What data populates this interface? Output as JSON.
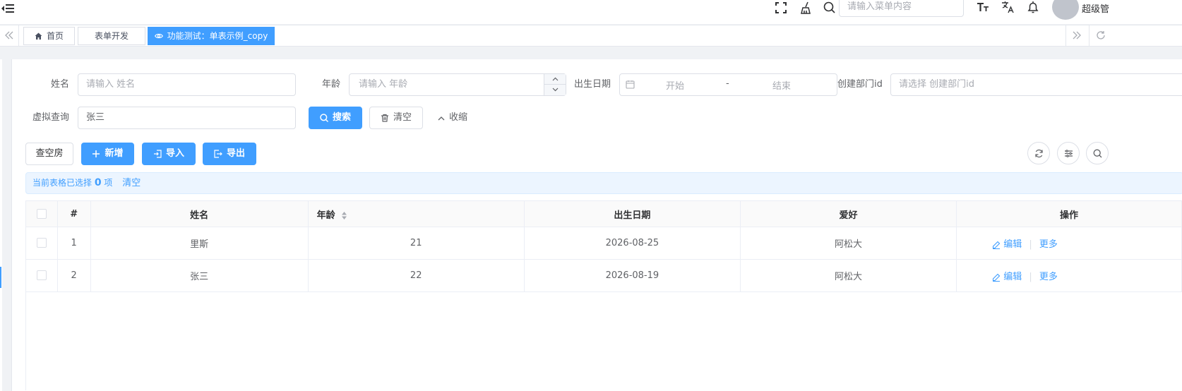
{
  "header": {
    "menu_search_placeholder": "请输入菜单内容",
    "user_name": "超级管"
  },
  "tags": [
    {
      "label": "首页"
    },
    {
      "label": "表单开发"
    },
    {
      "label": "功能测试：单表示例_copy"
    }
  ],
  "search_form": {
    "name_label": "姓名",
    "name_placeholder": "请输入 姓名",
    "age_label": "年龄",
    "age_placeholder": "请输入 年龄",
    "birth_label": "出生日期",
    "birth_start": "开始",
    "birth_sep": "-",
    "birth_end": "结束",
    "dept_label": "创建部门id",
    "dept_placeholder": "请选择 创建部门id",
    "virtual_label": "虚拟查询",
    "virtual_value": "张三",
    "search_label": "搜索",
    "reset_label": "清空",
    "collapse_label": "收缩"
  },
  "toolbar": {
    "room_label": "查空房",
    "add_label": "新增",
    "import_label": "导入",
    "export_label": "导出"
  },
  "selection": {
    "prefix": "当前表格已选择",
    "count": "0",
    "suffix": "项",
    "clear": "清空"
  },
  "table": {
    "columns": {
      "index": "#",
      "name": "姓名",
      "age": "年龄",
      "birth": "出生日期",
      "hobby": "爱好",
      "actions": "操作"
    },
    "rows": [
      {
        "index": "1",
        "name": "里斯",
        "age": "21",
        "birth": "2026-08-25",
        "hobby": "阿松大",
        "edit": "编辑",
        "more": "更多"
      },
      {
        "index": "2",
        "name": "张三",
        "age": "22",
        "birth": "2026-08-19",
        "hobby": "阿松大",
        "edit": "编辑",
        "more": "更多"
      }
    ]
  },
  "colors": {
    "primary": "#409eff",
    "border": "#dcdfe6"
  }
}
